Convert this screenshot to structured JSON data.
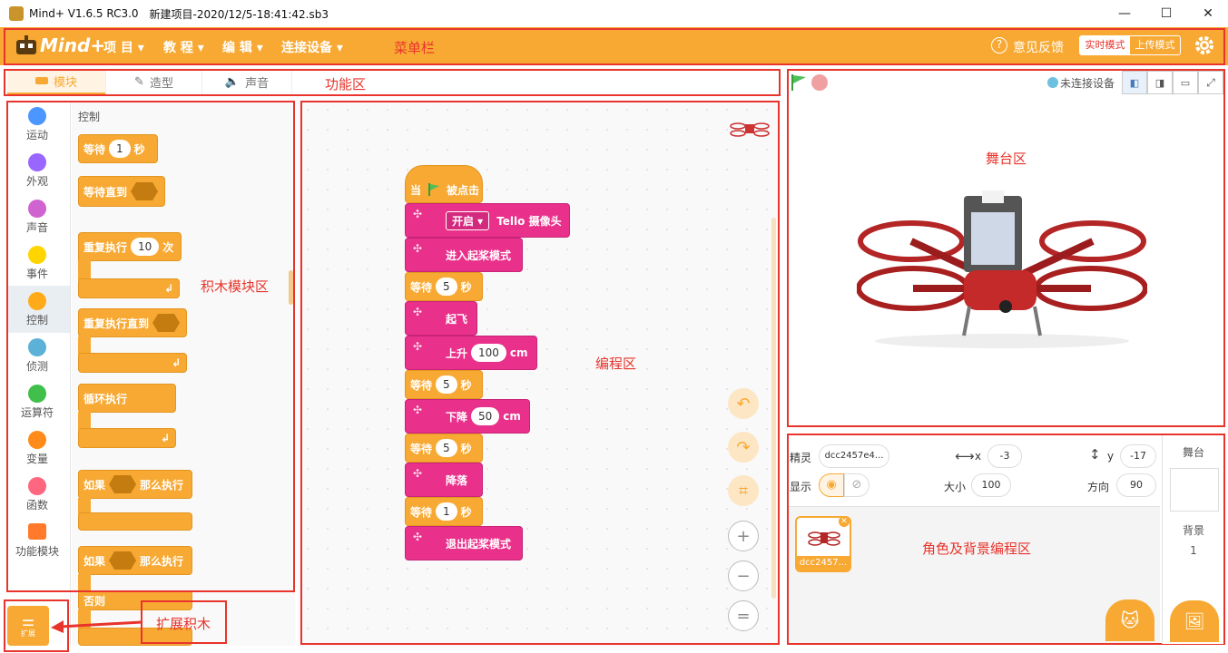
{
  "window": {
    "title": "Mind+ V1.6.5 RC3.0",
    "project": "新建项目-2020/12/5-18:41:42.sb3",
    "minimize": "—",
    "maximize": "☐",
    "close": "✕"
  },
  "menubar": {
    "logo": "Mind+",
    "items": [
      "项 目 ▾",
      "教 程 ▾",
      "编 辑 ▾",
      "连接设备 ▾"
    ],
    "annotation": "菜单栏",
    "feedback": "意见反馈",
    "mode_realtime": "实时模式",
    "mode_upload": "上传模式"
  },
  "tabs": {
    "items": [
      "模块",
      "造型",
      "声音"
    ],
    "annotation": "功能区"
  },
  "categories": [
    "运动",
    "外观",
    "声音",
    "事件",
    "控制",
    "侦测",
    "运算符",
    "变量",
    "函数",
    "功能模块"
  ],
  "colors": {
    "accent": "#f7a933",
    "pink": "#e9308a",
    "annotation_red": "#e8342c",
    "motion": "#4c97ff",
    "looks": "#9966ff",
    "sound": "#cf63cf",
    "events": "#ffd500",
    "control": "#ffab19",
    "sensing": "#5cb1d6",
    "operators": "#40bf4a",
    "variables": "#ff8c1a",
    "functions": "#ff6680"
  },
  "palette": {
    "title": "控制",
    "wait_label": "等待",
    "wait_value": "1",
    "wait_unit": "秒",
    "wait_until": "等待直到",
    "repeat": "重复执行",
    "repeat_value": "10",
    "repeat_unit": "次",
    "repeat_until": "重复执行直到",
    "forever": "循环执行",
    "if_label": "如果",
    "then_label": "那么执行",
    "else_label": "否则",
    "annotation": "积木模块区",
    "extension_label": "扩展",
    "extension_annotation": "扩展积木"
  },
  "script": {
    "hat_when": "当",
    "hat_clicked": "被点击",
    "dropdown": "开启 ▾",
    "camera": "Tello 摄像头",
    "enter_sdk": "进入起桨模式",
    "wait": "等待",
    "sec": "秒",
    "w1": "5",
    "takeoff": "起飞",
    "up": "上升",
    "up_val": "100",
    "cm": "cm",
    "w2": "5",
    "down": "下降",
    "down_val": "50",
    "w3": "5",
    "land": "降落",
    "w4": "1",
    "exit_sdk": "退出起桨模式",
    "annotation": "编程区"
  },
  "stage": {
    "status": "未连接设备",
    "annotation": "舞台区"
  },
  "sprite": {
    "label_sprite": "精灵",
    "name": "dcc2457e4...",
    "x_label": "x",
    "x": "-3",
    "y_label": "y",
    "y": "-17",
    "show_label": "显示",
    "size_label": "大小",
    "size": "100",
    "dir_label": "方向",
    "dir": "90",
    "thumb_name": "dcc2457...",
    "annotation": "角色及背景编程区",
    "stage_label": "舞台",
    "backdrop_label": "背景",
    "backdrop_count": "1"
  }
}
